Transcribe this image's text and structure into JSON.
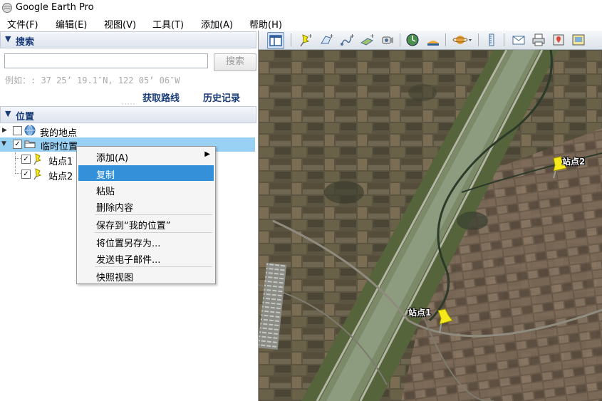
{
  "window": {
    "title": "Google Earth Pro"
  },
  "menubar": {
    "items": [
      "文件(F)",
      "编辑(E)",
      "视图(V)",
      "工具(T)",
      "添加(A)",
      "帮助(H)"
    ]
  },
  "search_panel": {
    "header": "搜索",
    "input_value": "",
    "button_label": "搜索",
    "hint": "例如：: 37 25’ 19.1″N, 122 05’ 06″W",
    "get_directions": "获取路线",
    "history": "历史记录"
  },
  "places_panel": {
    "header": "位置",
    "items": [
      {
        "label": "我的地点",
        "checked": false,
        "icon": "globe-icon"
      },
      {
        "label": "临时位置",
        "checked": true,
        "icon": "folder-icon"
      },
      {
        "label": "站点1",
        "checked": true,
        "icon": "yellow-pushpin-icon"
      },
      {
        "label": "站点2",
        "checked": true,
        "icon": "yellow-pushpin-icon"
      }
    ]
  },
  "context_menu": {
    "items": [
      {
        "label": "添加(A)",
        "submenu": true
      },
      {
        "label": "复制",
        "selected": true
      },
      {
        "label": "粘贴"
      },
      {
        "label": "删除内容"
      },
      {
        "label": "保存到“我的位置”"
      },
      {
        "label": "将位置另存为..."
      },
      {
        "label": "发送电子邮件..."
      },
      {
        "label": "快照视图"
      }
    ]
  },
  "toolbar": {
    "buttons": [
      "sidebar-toggle-icon",
      "placemark-icon",
      "polygon-icon",
      "path-icon",
      "image-overlay-icon",
      "record-tour-icon",
      "historical-imagery-icon",
      "sunlight-icon",
      "planets-icon",
      "ruler-icon",
      "email-icon",
      "print-icon",
      "google-maps-icon",
      "save-image-icon"
    ]
  },
  "map": {
    "placemarks": [
      {
        "label": "站点1"
      },
      {
        "label": "站点2"
      }
    ]
  },
  "colors": {
    "selection": "#99d1f4",
    "menu_highlight": "#3390d9",
    "header_text": "#1b3d7a",
    "pin_yellow": "#f5e81c"
  }
}
